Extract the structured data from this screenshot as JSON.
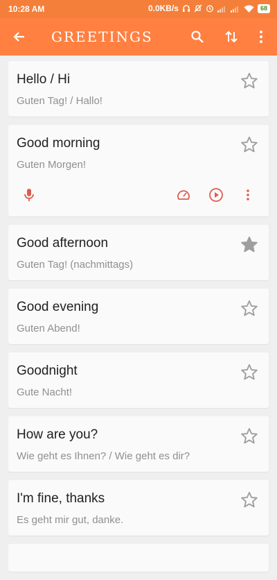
{
  "status_bar": {
    "time": "10:28 AM",
    "net_speed": "0.0KB/s",
    "battery": "68"
  },
  "app_bar": {
    "title": "GREETINGS",
    "back_icon": "arrow-left-icon",
    "search_icon": "search-icon",
    "swap_icon": "swap-vertical-icon",
    "menu_icon": "more-vertical-icon"
  },
  "colors": {
    "app_bar": "#ff8040",
    "status_bar": "#f47f3a",
    "action_icons": "#e05a4f",
    "star": "#9e9e9e"
  },
  "phrases": [
    {
      "english": "Hello / Hi",
      "german": "Guten Tag! / Hallo!",
      "starred": false
    },
    {
      "english": "Good morning",
      "german": "Guten Morgen!",
      "starred": false,
      "expanded": true
    },
    {
      "english": "Good afternoon",
      "german": "Guten Tag! (nachmittags)",
      "starred": true
    },
    {
      "english": "Good evening",
      "german": "Guten Abend!",
      "starred": false
    },
    {
      "english": "Goodnight",
      "german": "Gute Nacht!",
      "starred": false
    },
    {
      "english": "How are you?",
      "german": "Wie geht es Ihnen? / Wie geht es dir?",
      "starred": false
    },
    {
      "english": "I'm fine, thanks",
      "german": "Es geht mir gut, danke.",
      "starred": false
    }
  ]
}
